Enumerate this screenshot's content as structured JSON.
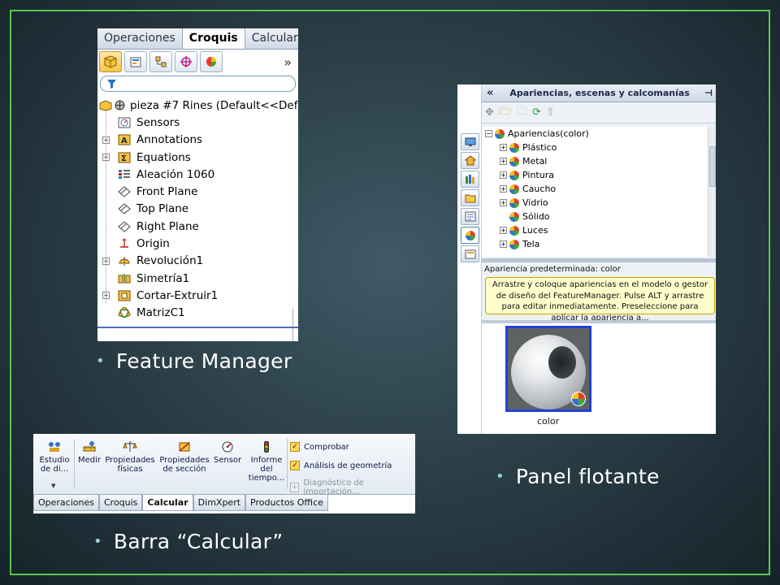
{
  "bullets": {
    "feature_manager": "Feature Manager",
    "panel_flotante": "Panel flotante",
    "barra_calcular": "Barra “Calcular”"
  },
  "feature_manager": {
    "tabs": [
      "Operaciones",
      "Croquis",
      "Calcular"
    ],
    "active_tab": "Croquis",
    "more": "»",
    "root": "pieza #7 Rines  (Default<<Def",
    "items": [
      {
        "label": "Sensors",
        "icon": "sensors-icon",
        "expand": false
      },
      {
        "label": "Annotations",
        "icon": "annotations-icon",
        "expand": true
      },
      {
        "label": "Equations",
        "icon": "equations-icon",
        "expand": true
      },
      {
        "label": "Aleación 1060",
        "icon": "material-icon",
        "expand": false
      },
      {
        "label": "Front Plane",
        "icon": "plane-icon",
        "expand": false
      },
      {
        "label": "Top Plane",
        "icon": "plane-icon",
        "expand": false
      },
      {
        "label": "Right Plane",
        "icon": "plane-icon",
        "expand": false
      },
      {
        "label": "Origin",
        "icon": "origin-icon",
        "expand": false
      },
      {
        "label": "Revolución1",
        "icon": "revolve-icon",
        "expand": true
      },
      {
        "label": "Simetría1",
        "icon": "mirror-icon",
        "expand": false
      },
      {
        "label": "Cortar-Extruir1",
        "icon": "cut-extrude-icon",
        "expand": true
      },
      {
        "label": "MatrizC1",
        "icon": "pattern-icon",
        "expand": false
      }
    ]
  },
  "panel_flotante": {
    "title": "Apariencias, escenas y calcomanías",
    "collapse": "«",
    "root": "Apariencias(color)",
    "items": [
      "Plástico",
      "Metal",
      "Pintura",
      "Caucho",
      "Vidrio",
      "Sólido",
      "Luces",
      "Tela"
    ],
    "no_expand": [
      "Sólido"
    ],
    "default_label": "Apariencia predeterminada: color",
    "tip": "Arrastre y coloque apariencias en el modelo o gestor de diseño del FeatureManager. Pulse ALT y arrastre para editar inmediatamente. Preseleccione para aplicar la apariencia a...",
    "thumbnail_label": "color"
  },
  "barra_calcular": {
    "buttons": [
      {
        "label": "Estudio de di...",
        "icon": "design-study-icon"
      },
      {
        "label": "Medir",
        "icon": "measure-icon"
      },
      {
        "label": "Propiedades físicas",
        "icon": "mass-properties-icon"
      },
      {
        "label": "Propiedades de sección",
        "icon": "section-properties-icon"
      },
      {
        "label": "Sensor",
        "icon": "sensor-icon"
      },
      {
        "label": "Informe del tiempo...",
        "icon": "performance-icon"
      }
    ],
    "checks": [
      {
        "label": "Comprobar",
        "enabled": true
      },
      {
        "label": "Análisis de geometría",
        "enabled": true
      },
      {
        "label": "Diagnóstico de importación...",
        "enabled": false
      }
    ],
    "tabs": [
      "Operaciones",
      "Croquis",
      "Calcular",
      "DimXpert",
      "Productos Office"
    ],
    "active_tab": "Calcular"
  },
  "colors": {
    "frame": "#57c84a",
    "highlight_border": "#1f3fe0",
    "tooltip_bg": "#ffffcc"
  }
}
